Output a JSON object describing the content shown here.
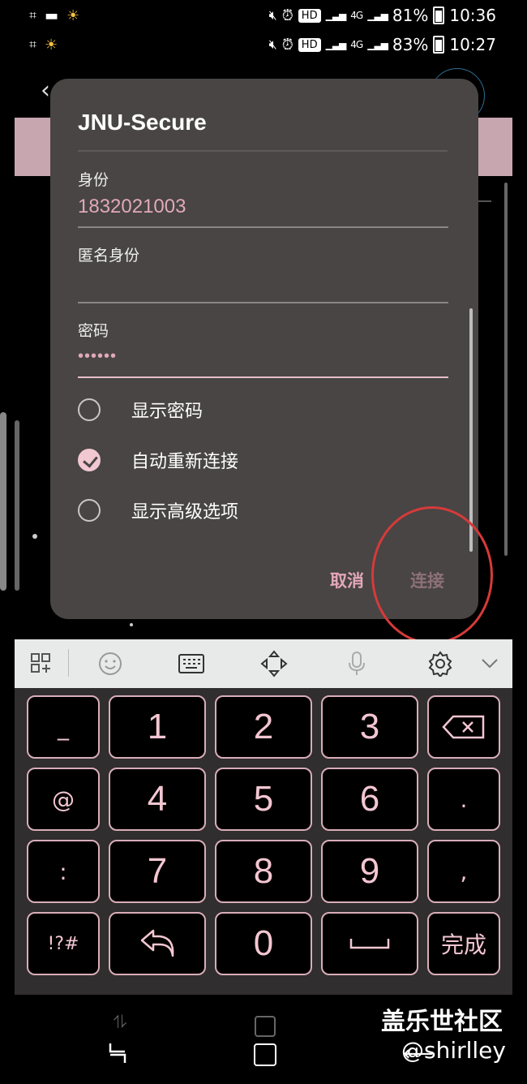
{
  "status_bar_top": {
    "battery": "81%",
    "time": "10:36",
    "hd": "HD",
    "network": "4G"
  },
  "status_bar_second": {
    "battery": "83%",
    "time": "10:27",
    "hd": "HD",
    "network": "4G"
  },
  "dialog": {
    "title": "JNU-Secure",
    "identity_label": "身份",
    "identity_value": "1832021003",
    "anonymous_label": "匿名身份",
    "anonymous_value": "",
    "password_label": "密码",
    "password_value": "••••••",
    "options": [
      {
        "label": "显示密码",
        "checked": false
      },
      {
        "label": "自动重新连接",
        "checked": true
      },
      {
        "label": "显示高级选项",
        "checked": false
      }
    ],
    "cancel_label": "取消",
    "connect_label": "连接"
  },
  "keyboard": {
    "toolbar_icons": [
      "apps-icon",
      "emoji-icon",
      "keyboard-icon",
      "move-icon",
      "mic-icon",
      "settings-icon",
      "chevron-down-icon"
    ],
    "keys": {
      "underscore": "_",
      "k1": "1",
      "k2": "2",
      "k3": "3",
      "at": "@",
      "k4": "4",
      "k5": "5",
      "k6": "6",
      "dot": ".",
      "colon": ":",
      "k7": "7",
      "k8": "8",
      "k9": "9",
      "comma": ",",
      "symbols": "!?#",
      "k0": "0",
      "done": "完成"
    }
  },
  "watermark": {
    "site": "盖乐世社区",
    "user": "@shirlley"
  },
  "colors": {
    "accent_pink": "#e3a7b9",
    "dialog_bg": "#484544",
    "annotation_red": "#d63a3a"
  }
}
